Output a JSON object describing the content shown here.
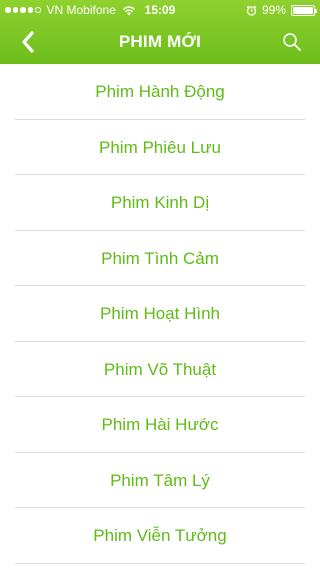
{
  "status_bar": {
    "carrier": "VN Mobifone",
    "time": "15:09",
    "battery": "99%",
    "battery_level": 0.99,
    "signal_bars": 4,
    "signal_total": 5,
    "icons": [
      "signal-dots-icon",
      "wifi-icon",
      "alarm-icon",
      "battery-icon"
    ]
  },
  "nav": {
    "title": "PHIM MỚI",
    "back_icon": "chevron-left-icon",
    "search_icon": "search-icon"
  },
  "categories": [
    {
      "label": "Phim Hành Động"
    },
    {
      "label": "Phim Phiêu Lưu"
    },
    {
      "label": "Phim Kinh Dị"
    },
    {
      "label": "Phim Tình Cảm"
    },
    {
      "label": "Phim Hoạt Hình"
    },
    {
      "label": "Phim Võ Thuật"
    },
    {
      "label": "Phim Hài Hước"
    },
    {
      "label": "Phim Tâm Lý"
    },
    {
      "label": "Phim Viễn Tưởng"
    }
  ],
  "colors": {
    "header_green": "#7cc825",
    "text_green": "#5fbb16",
    "divider": "#dcdcdc"
  }
}
